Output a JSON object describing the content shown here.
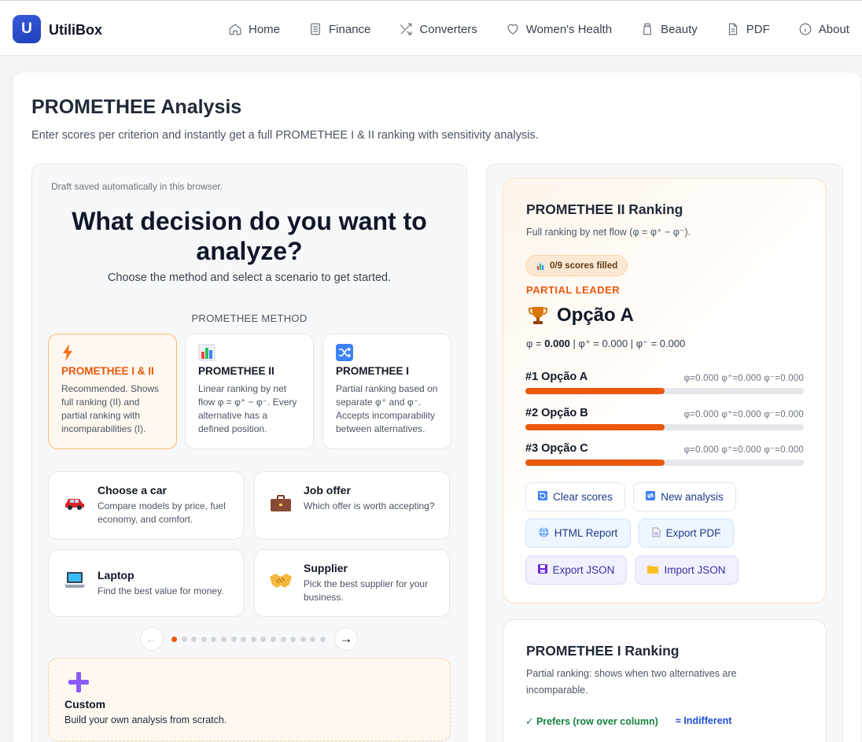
{
  "brand": {
    "logo_letter": "U",
    "name": "UtiliBox"
  },
  "nav": [
    {
      "label": "Home",
      "icon": "home-icon"
    },
    {
      "label": "Finance",
      "icon": "document-icon"
    },
    {
      "label": "Converters",
      "icon": "shuffle-icon"
    },
    {
      "label": "Women's Health",
      "icon": "heart-icon"
    },
    {
      "label": "Beauty",
      "icon": "jar-icon"
    },
    {
      "label": "PDF",
      "icon": "file-icon"
    },
    {
      "label": "About",
      "icon": "info-icon"
    }
  ],
  "page": {
    "title": "PROMETHEE Analysis",
    "subtitle": "Enter scores per criterion and instantly get a full PROMETHEE I & II ranking with sensitivity analysis."
  },
  "setup": {
    "draft_note": "Draft saved automatically in this browser.",
    "heading": "What decision do you want to analyze?",
    "subheading": "Choose the method and select a scenario to get started.",
    "method_label": "PROMETHEE METHOD",
    "methods": [
      {
        "title": "PROMETHEE I & II",
        "desc": "Recommended. Shows full ranking (II) and partial ranking with incomparabilities (I).",
        "icon": "lightning-icon",
        "selected": true
      },
      {
        "title": "PROMETHEE II",
        "desc": "Linear ranking by net flow φ = φ⁺ − φ⁻. Every alternative has a defined position.",
        "icon": "bar-chart-icon",
        "selected": false
      },
      {
        "title": "PROMETHEE I",
        "desc": "Partial ranking based on separate φ⁺ and φ⁻. Accepts incomparability between alternatives.",
        "icon": "shuffle-icon",
        "selected": false
      }
    ],
    "scenarios": [
      {
        "title": "Choose a car",
        "desc": "Compare models by price, fuel economy, and comfort.",
        "icon": "car-icon"
      },
      {
        "title": "Job offer",
        "desc": "Which offer is worth accepting?",
        "icon": "briefcase-icon"
      },
      {
        "title": "Laptop",
        "desc": "Find the best value for money.",
        "icon": "laptop-icon"
      },
      {
        "title": "Supplier",
        "desc": "Pick the best supplier for your business.",
        "icon": "handshake-icon"
      }
    ],
    "pager": {
      "prev": "←",
      "next": "→",
      "pages": 16,
      "active": 0
    },
    "custom": {
      "title": "Custom",
      "desc": "Build your own analysis from scratch.",
      "icon": "plus-icon"
    }
  },
  "ranking2": {
    "title": "PROMETHEE II Ranking",
    "subtitle": "Full ranking by net flow (φ = φ⁺ − φ⁻).",
    "badge": "0/9 scores filled",
    "leader_label": "PARTIAL LEADER",
    "leader_name": "Opção A",
    "flow_phi_label": "φ =",
    "flow_phi_value": "0.000",
    "flow_rest": "| φ⁺ = 0.000 | φ⁻ = 0.000",
    "rows": [
      {
        "label": "#1 Opção A",
        "values": "φ=0.000   φ⁺=0.000   φ⁻=0.000",
        "fill": 0.5
      },
      {
        "label": "#2 Opção B",
        "values": "φ=0.000   φ⁺=0.000   φ⁻=0.000",
        "fill": 0.5
      },
      {
        "label": "#3 Opção C",
        "values": "φ=0.000   φ⁺=0.000   φ⁻=0.000",
        "fill": 0.5
      }
    ],
    "actions": {
      "clear": "Clear scores",
      "new": "New analysis",
      "html": "HTML Report",
      "pdf": "Export PDF",
      "export_json": "Export JSON",
      "import_json": "Import JSON"
    }
  },
  "ranking1": {
    "title": "PROMETHEE I Ranking",
    "subtitle": "Partial ranking: shows when two alternatives are incomparable.",
    "legend_prefers": "✓ Prefers (row over column)",
    "legend_indifferent": "≈ Indifferent"
  },
  "colors": {
    "accent": "#ea580c",
    "brand": "#2f4fd0"
  }
}
